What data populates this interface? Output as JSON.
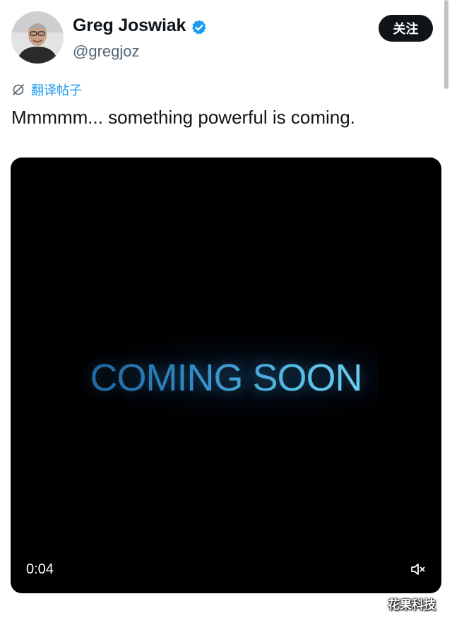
{
  "post": {
    "author": {
      "name": "Greg Joswiak",
      "handle": "@gregjoz",
      "verified": true,
      "avatar_icon": "profile-photo"
    },
    "follow_label": "关注",
    "translate_label": "翻译帖子",
    "text": "Mmmmm... something powerful is coming.",
    "media": {
      "overlay_text": "COMING SOON",
      "timestamp": "0:04",
      "muted": true
    }
  },
  "watermark": "花果科技",
  "colors": {
    "accent": "#1d9bf0",
    "text": "#0f1419",
    "secondary_text": "#536471",
    "button_bg": "#0f1419"
  }
}
